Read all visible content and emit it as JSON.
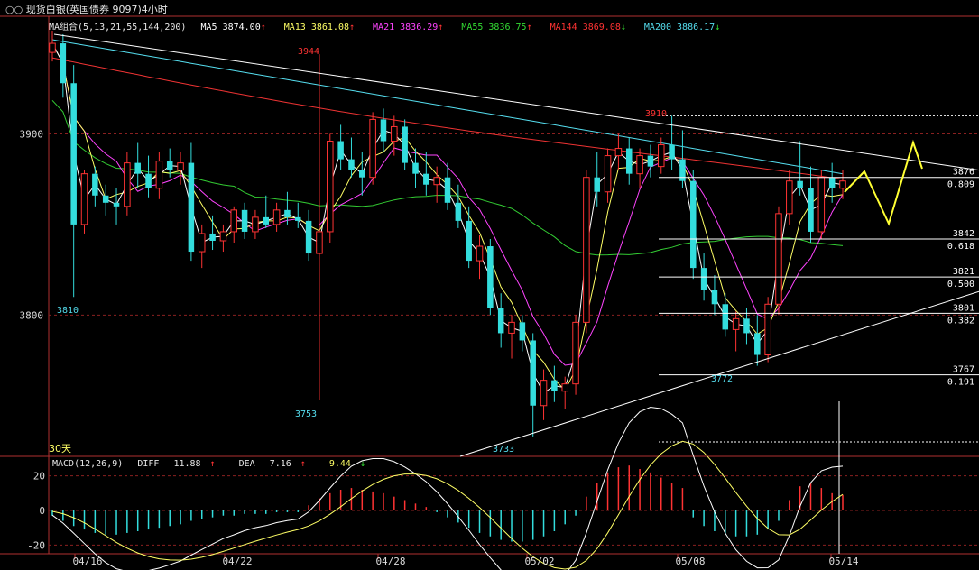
{
  "header": {
    "title": "现货白银(英国债券 9097)4小时",
    "period_label": "30天"
  },
  "ma_bar": {
    "group_label": "MA组合(5,13,21,55,144,200)",
    "items": [
      {
        "label": "MA5",
        "value": "3874.00",
        "arrow": "↑",
        "color": "#ffffff"
      },
      {
        "label": "MA13",
        "value": "3861.08",
        "arrow": "↑",
        "color": "#ffff66"
      },
      {
        "label": "MA21",
        "value": "3836.29",
        "arrow": "↑",
        "color": "#ff44ff"
      },
      {
        "label": "MA55",
        "value": "3836.75",
        "arrow": "↑",
        "color": "#33dd33"
      },
      {
        "label": "MA144",
        "value": "3869.08",
        "arrow": "↓",
        "color": "#ff3333"
      },
      {
        "label": "MA200",
        "value": "3886.17",
        "arrow": "↓",
        "color": "#55ddee"
      }
    ]
  },
  "macd_bar": {
    "label": "MACD(12,26,9)",
    "diff_label": "DIFF",
    "diff_value": "11.88",
    "diff_arrow": "↑",
    "dea_label": "DEA",
    "dea_value": "7.16",
    "dea_arrow": "↑",
    "macd_value": "9.44",
    "macd_arrow": "↓"
  },
  "chart_data": {
    "type": "candlestick",
    "x_tick_labels": [
      "04/16",
      "04/22",
      "04/28",
      "05/02",
      "05/08",
      "05/14"
    ],
    "y_tick_labels": [
      3900,
      3800
    ],
    "price_range": [
      3722,
      3957
    ],
    "price_annotations": [
      {
        "label": "3944",
        "value": 3944
      },
      {
        "label": "3810",
        "value": 3810
      },
      {
        "label": "3753",
        "value": 3753
      },
      {
        "label": "3733",
        "value": 3733
      },
      {
        "label": "3910",
        "value": 3910
      },
      {
        "label": "3772",
        "value": 3772
      }
    ],
    "fib_levels": [
      {
        "price": 3876,
        "ratio": "0.809",
        "price_label": "3876"
      },
      {
        "price": 3842,
        "ratio": "0.618",
        "price_label": "3842"
      },
      {
        "price": 3821,
        "ratio": "0.500",
        "price_label": "3821"
      },
      {
        "price": 3801,
        "ratio": "0.382",
        "price_label": "3801"
      },
      {
        "price": 3767,
        "ratio": "0.191",
        "price_label": "3767"
      }
    ],
    "macd_range": [
      -24,
      24
    ],
    "macd_ticks": [
      20,
      0,
      -20
    ],
    "candles": [
      {
        "o": 3945,
        "h": 3957,
        "l": 3940,
        "c": 3950
      },
      {
        "o": 3950,
        "h": 3955,
        "l": 3920,
        "c": 3928
      },
      {
        "o": 3928,
        "h": 3938,
        "l": 3810,
        "c": 3850
      },
      {
        "o": 3850,
        "h": 3880,
        "l": 3845,
        "c": 3878
      },
      {
        "o": 3878,
        "h": 3882,
        "l": 3860,
        "c": 3866
      },
      {
        "o": 3866,
        "h": 3872,
        "l": 3855,
        "c": 3862
      },
      {
        "o": 3862,
        "h": 3870,
        "l": 3850,
        "c": 3860
      },
      {
        "o": 3860,
        "h": 3890,
        "l": 3855,
        "c": 3884
      },
      {
        "o": 3884,
        "h": 3895,
        "l": 3870,
        "c": 3878
      },
      {
        "o": 3878,
        "h": 3888,
        "l": 3865,
        "c": 3870
      },
      {
        "o": 3870,
        "h": 3890,
        "l": 3864,
        "c": 3885
      },
      {
        "o": 3885,
        "h": 3892,
        "l": 3876,
        "c": 3880
      },
      {
        "o": 3880,
        "h": 3890,
        "l": 3872,
        "c": 3884
      },
      {
        "o": 3884,
        "h": 3895,
        "l": 3830,
        "c": 3835
      },
      {
        "o": 3835,
        "h": 3850,
        "l": 3826,
        "c": 3845
      },
      {
        "o": 3845,
        "h": 3855,
        "l": 3836,
        "c": 3841
      },
      {
        "o": 3841,
        "h": 3850,
        "l": 3835,
        "c": 3846
      },
      {
        "o": 3846,
        "h": 3860,
        "l": 3840,
        "c": 3858
      },
      {
        "o": 3858,
        "h": 3862,
        "l": 3842,
        "c": 3846
      },
      {
        "o": 3846,
        "h": 3858,
        "l": 3842,
        "c": 3854
      },
      {
        "o": 3854,
        "h": 3866,
        "l": 3848,
        "c": 3850
      },
      {
        "o": 3850,
        "h": 3862,
        "l": 3846,
        "c": 3858
      },
      {
        "o": 3858,
        "h": 3868,
        "l": 3850,
        "c": 3854
      },
      {
        "o": 3854,
        "h": 3862,
        "l": 3848,
        "c": 3852
      },
      {
        "o": 3852,
        "h": 3858,
        "l": 3830,
        "c": 3834
      },
      {
        "o": 3834,
        "h": 3944,
        "l": 3753,
        "c": 3846
      },
      {
        "o": 3846,
        "h": 3900,
        "l": 3840,
        "c": 3896
      },
      {
        "o": 3896,
        "h": 3905,
        "l": 3880,
        "c": 3886
      },
      {
        "o": 3886,
        "h": 3898,
        "l": 3876,
        "c": 3880
      },
      {
        "o": 3880,
        "h": 3890,
        "l": 3866,
        "c": 3876
      },
      {
        "o": 3876,
        "h": 3912,
        "l": 3872,
        "c": 3908
      },
      {
        "o": 3908,
        "h": 3914,
        "l": 3890,
        "c": 3896
      },
      {
        "o": 3896,
        "h": 3910,
        "l": 3888,
        "c": 3904
      },
      {
        "o": 3904,
        "h": 3908,
        "l": 3880,
        "c": 3884
      },
      {
        "o": 3884,
        "h": 3892,
        "l": 3870,
        "c": 3878
      },
      {
        "o": 3878,
        "h": 3890,
        "l": 3866,
        "c": 3872
      },
      {
        "o": 3872,
        "h": 3882,
        "l": 3862,
        "c": 3876
      },
      {
        "o": 3876,
        "h": 3884,
        "l": 3858,
        "c": 3862
      },
      {
        "o": 3862,
        "h": 3872,
        "l": 3848,
        "c": 3852
      },
      {
        "o": 3852,
        "h": 3860,
        "l": 3826,
        "c": 3830
      },
      {
        "o": 3830,
        "h": 3844,
        "l": 3820,
        "c": 3838
      },
      {
        "o": 3838,
        "h": 3842,
        "l": 3800,
        "c": 3804
      },
      {
        "o": 3804,
        "h": 3812,
        "l": 3782,
        "c": 3790
      },
      {
        "o": 3790,
        "h": 3800,
        "l": 3776,
        "c": 3796
      },
      {
        "o": 3796,
        "h": 3800,
        "l": 3780,
        "c": 3786
      },
      {
        "o": 3786,
        "h": 3790,
        "l": 3733,
        "c": 3750
      },
      {
        "o": 3750,
        "h": 3770,
        "l": 3742,
        "c": 3764
      },
      {
        "o": 3764,
        "h": 3772,
        "l": 3752,
        "c": 3758
      },
      {
        "o": 3758,
        "h": 3766,
        "l": 3748,
        "c": 3762
      },
      {
        "o": 3762,
        "h": 3800,
        "l": 3756,
        "c": 3796
      },
      {
        "o": 3796,
        "h": 3880,
        "l": 3790,
        "c": 3876
      },
      {
        "o": 3876,
        "h": 3890,
        "l": 3860,
        "c": 3868
      },
      {
        "o": 3868,
        "h": 3892,
        "l": 3862,
        "c": 3888
      },
      {
        "o": 3888,
        "h": 3900,
        "l": 3880,
        "c": 3892
      },
      {
        "o": 3892,
        "h": 3898,
        "l": 3872,
        "c": 3878
      },
      {
        "o": 3878,
        "h": 3892,
        "l": 3870,
        "c": 3888
      },
      {
        "o": 3888,
        "h": 3894,
        "l": 3876,
        "c": 3882
      },
      {
        "o": 3882,
        "h": 3898,
        "l": 3878,
        "c": 3894
      },
      {
        "o": 3894,
        "h": 3910,
        "l": 3880,
        "c": 3886
      },
      {
        "o": 3886,
        "h": 3902,
        "l": 3870,
        "c": 3874
      },
      {
        "o": 3874,
        "h": 3880,
        "l": 3820,
        "c": 3826
      },
      {
        "o": 3826,
        "h": 3834,
        "l": 3808,
        "c": 3814
      },
      {
        "o": 3814,
        "h": 3822,
        "l": 3800,
        "c": 3806
      },
      {
        "o": 3806,
        "h": 3812,
        "l": 3788,
        "c": 3792
      },
      {
        "o": 3792,
        "h": 3802,
        "l": 3780,
        "c": 3798
      },
      {
        "o": 3798,
        "h": 3804,
        "l": 3784,
        "c": 3790
      },
      {
        "o": 3790,
        "h": 3800,
        "l": 3772,
        "c": 3778
      },
      {
        "o": 3778,
        "h": 3810,
        "l": 3774,
        "c": 3806
      },
      {
        "o": 3806,
        "h": 3860,
        "l": 3800,
        "c": 3856
      },
      {
        "o": 3856,
        "h": 3880,
        "l": 3850,
        "c": 3874
      },
      {
        "o": 3874,
        "h": 3896,
        "l": 3866,
        "c": 3870
      },
      {
        "o": 3870,
        "h": 3882,
        "l": 3840,
        "c": 3846
      },
      {
        "o": 3846,
        "h": 3880,
        "l": 3842,
        "c": 3876
      },
      {
        "o": 3876,
        "h": 3884,
        "l": 3862,
        "c": 3870
      },
      {
        "o": 3870,
        "h": 3880,
        "l": 3864,
        "c": 3874
      }
    ],
    "macd_hist": [
      -3,
      -6,
      -9,
      -11,
      -13,
      -14,
      -14,
      -13,
      -12,
      -11,
      -10,
      -9,
      -8,
      -6,
      -5,
      -4,
      -3,
      -3,
      -2,
      -2,
      -2,
      -1,
      -1,
      -1,
      3,
      7,
      10,
      12,
      13,
      12,
      11,
      10,
      8,
      6,
      4,
      2,
      -1,
      -4,
      -7,
      -10,
      -13,
      -15,
      -17,
      -18,
      -18,
      -17,
      -15,
      -12,
      -8,
      -3,
      8,
      16,
      22,
      25,
      26,
      24,
      22,
      19,
      16,
      13,
      -4,
      -9,
      -12,
      -14,
      -15,
      -15,
      -14,
      -11,
      -6,
      6,
      14,
      16,
      13,
      10,
      9
    ]
  }
}
